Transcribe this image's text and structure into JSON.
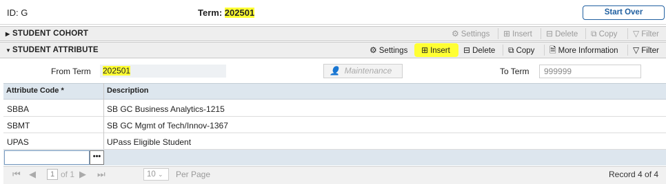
{
  "header": {
    "id_label": "ID:",
    "id_value": "G",
    "term_label": "Term:",
    "term_value": "202501",
    "start_over": "Start Over"
  },
  "cohort_section": {
    "title": "STUDENT COHORT",
    "toolbar": {
      "settings": "Settings",
      "insert": "Insert",
      "delete": "Delete",
      "copy": "Copy",
      "filter": "Filter"
    }
  },
  "attribute_section": {
    "title": "STUDENT ATTRIBUTE",
    "toolbar": {
      "settings": "Settings",
      "insert": "Insert",
      "delete": "Delete",
      "copy": "Copy",
      "more_info": "More Information",
      "filter": "Filter"
    }
  },
  "key_block": {
    "from_term_label": "From Term",
    "from_term_value": "202501",
    "maintenance_placeholder": "Maintenance",
    "to_term_label": "To Term",
    "to_term_value": "999999"
  },
  "grid": {
    "columns": [
      "Attribute Code *",
      "Description"
    ],
    "rows": [
      [
        "SBBA",
        "SB GC Business Analytics-1215"
      ],
      [
        "SBMT",
        "SB GC Mgmt of Tech/Innov-1367"
      ],
      [
        "UPAS",
        "UPass Eligible Student"
      ]
    ],
    "lookup_button": "•••"
  },
  "pager": {
    "page_value": "1",
    "of_pages": "of 1",
    "per_page_value": "10",
    "per_page_label": "Per Page",
    "record_text": "Record 4 of 4"
  }
}
